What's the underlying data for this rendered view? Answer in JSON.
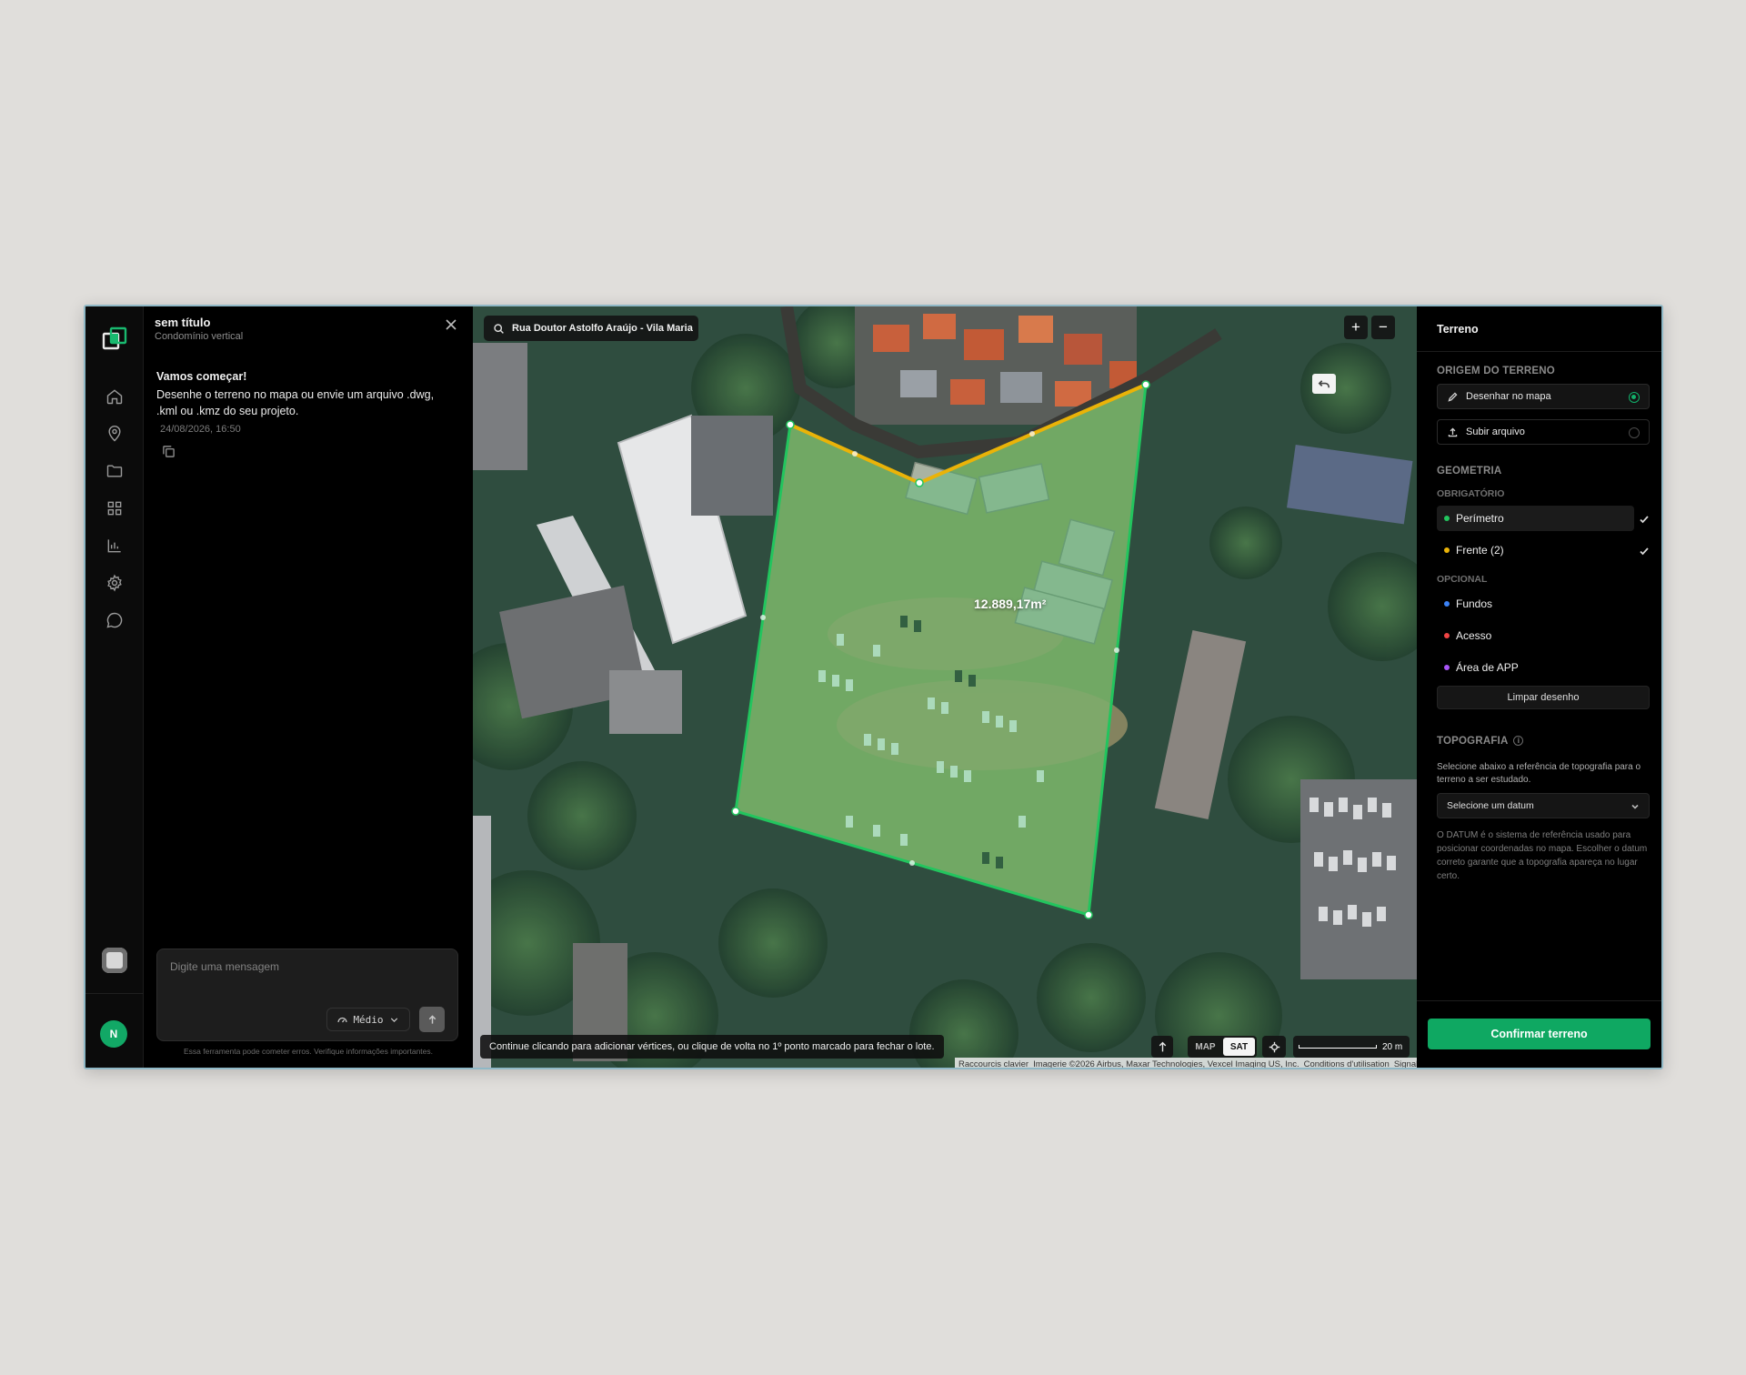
{
  "chat": {
    "title": "sem título",
    "subtitle": "Condomínio vertical",
    "message_title": "Vamos começar!",
    "message_body": "Desenhe o terreno no mapa ou envie um arquivo .dwg, .kml ou .kmz do seu projeto.",
    "message_time": "24/08/2026, 16:50",
    "composer_placeholder": "Digite uma mensagem",
    "model_label": "Médio",
    "disclaimer": "Essa ferramenta pode cometer erros. Verifique informações importantes."
  },
  "user": {
    "initial": "N"
  },
  "map": {
    "search_text": "Rua Doutor Astolfo Araújo - Vila Maria",
    "area_label": "12.889,17m²",
    "hint": "Continue clicando para adicionar vértices, ou clique de volta no 1º ponto marcado para fechar o lote.",
    "type_map": "MAP",
    "type_sat": "SAT",
    "scale_label": "20 m",
    "attribution": {
      "shortcuts": "Raccourcis clavier",
      "imagery": "Imagerie ©2026 Airbus, Maxar Technologies, Vexcel Imaging US, Inc.",
      "terms": "Conditions d'utilisation",
      "report": "Signaler une erreur cartographique"
    }
  },
  "terrain": {
    "title": "Terreno",
    "origin_heading": "ORIGEM DO TERRENO",
    "origin_options": [
      "Desenhar no mapa",
      "Subir arquivo"
    ],
    "origin_selected": "Desenhar no mapa",
    "geometry_heading": "GEOMETRIA",
    "required_heading": "OBRIGATÓRIO",
    "required_items": [
      {
        "label": "Perímetro",
        "color": "#22c55e",
        "done": true
      },
      {
        "label": "Frente (2)",
        "color": "#eab308",
        "done": true
      }
    ],
    "optional_heading": "OPCIONAL",
    "optional_items": [
      {
        "label": "Fundos",
        "color": "#3b82f6"
      },
      {
        "label": "Acesso",
        "color": "#ef4444"
      },
      {
        "label": "Área de APP",
        "color": "#a855f7"
      }
    ],
    "clear_label": "Limpar desenho",
    "topo_heading": "TOPOGRAFIA",
    "topo_desc": "Selecione abaixo a referência de topografia para o terreno a ser estudado.",
    "datum_placeholder": "Selecione um datum",
    "datum_help": "O DATUM é o sistema de referência usado para posicionar coordenadas no mapa. Escolher o datum correto garante que a topografia apareça no lugar certo.",
    "confirm_label": "Confirmar terreno"
  },
  "colors": {
    "accent": "#0fa862",
    "perimeter": "#22c55e",
    "front": "#eab308"
  }
}
